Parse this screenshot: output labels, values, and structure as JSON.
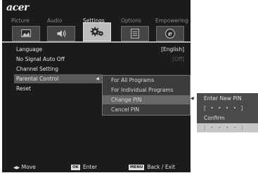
{
  "brand": {
    "logo": "acer"
  },
  "tabs": [
    {
      "label": "Picture",
      "icon": "picture-icon",
      "active": false
    },
    {
      "label": "Audio",
      "icon": "audio-icon",
      "active": false
    },
    {
      "label": "Settings",
      "icon": "settings-icon",
      "active": true
    },
    {
      "label": "Options",
      "icon": "options-icon",
      "active": false
    },
    {
      "label": "Empowering",
      "icon": "empowering-icon",
      "active": false
    }
  ],
  "menu": {
    "items": [
      {
        "label": "Language",
        "value": "[English]"
      },
      {
        "label": "No Signal Auto Off",
        "value": "[Off]"
      },
      {
        "label": "Channel Setting",
        "value": ""
      },
      {
        "label": "Parental Control",
        "value": ""
      },
      {
        "label": "Reset",
        "value": ""
      }
    ],
    "selected": "Parental Control"
  },
  "parental_submenu": {
    "items": [
      {
        "label": "For All Programs"
      },
      {
        "label": "For Individual Programs"
      },
      {
        "label": "Change PIN"
      },
      {
        "label": "Cancel PIN"
      }
    ],
    "selected": "Change PIN"
  },
  "pin_panel": {
    "enter_label": "Enter New PIN",
    "new_pin": "[ • • • • ]",
    "confirm_label": "Confirm",
    "confirm_pin": "[ • • • • ]"
  },
  "footer": {
    "move_label": "Move",
    "ok_badge": "OK",
    "enter_label": "Enter",
    "menu_badge": "MENU",
    "back_label": "Back / Exit"
  },
  "colors": {
    "osd_bg": "#1b1b1b",
    "highlight": "#5a5a5a",
    "pin_panel_bg": "#4a4a4a"
  }
}
